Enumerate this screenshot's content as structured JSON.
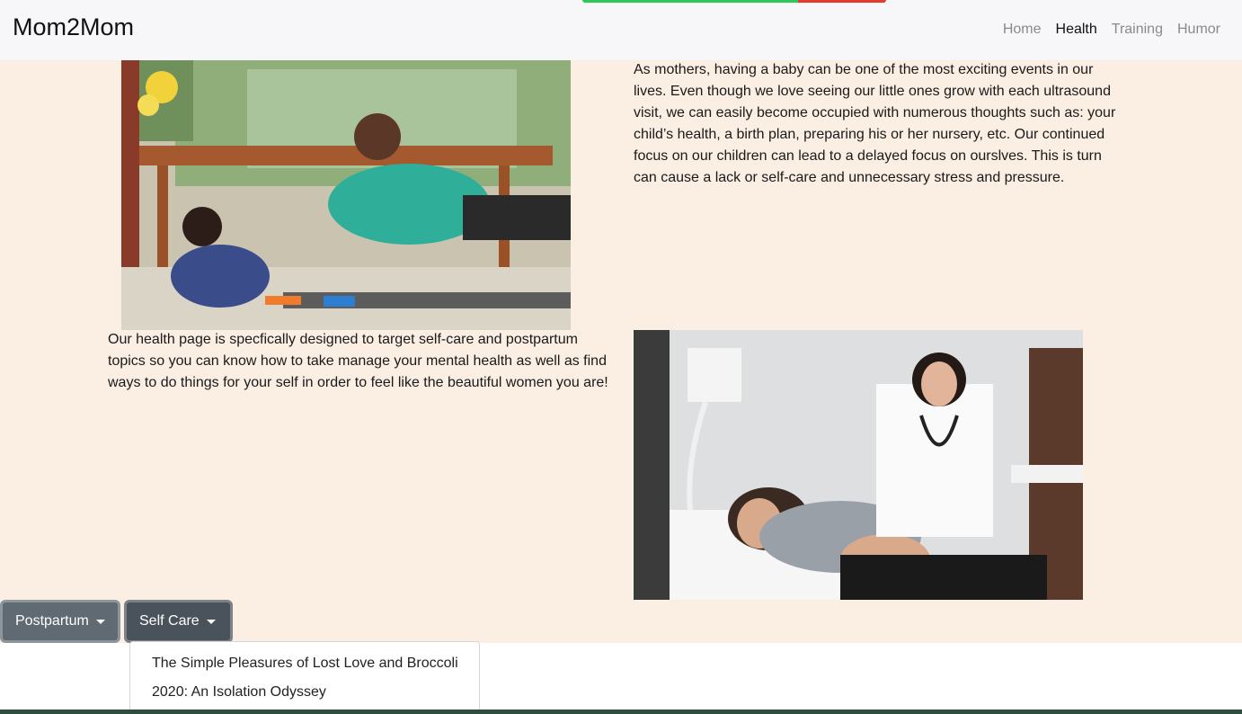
{
  "navbar": {
    "brand": "Mom2Mom",
    "links": [
      {
        "label": "Home",
        "active": false
      },
      {
        "label": "Health",
        "active": true
      },
      {
        "label": "Training",
        "active": false
      },
      {
        "label": "Humor",
        "active": false
      }
    ],
    "progress": {
      "filled_fraction": 0.71,
      "fill_color": "#2ec95a",
      "rest_color": "#e23b2e"
    }
  },
  "content": {
    "background_color": "#fbeee2",
    "paragraph_1": "As mothers, having a baby can be one of the most exciting events in our lives. Even though we love seeing our little ones grow with each ultrasound visit, we can easily become occupied with numerous thoughts such as: your child’s health, a birth plan, preparing his or her nursery, etc. Our continued focus on our children can lead to a delayed focus on ourslves. This is turn can cause a lack or self-care and unnecessary stress and pressure.",
    "paragraph_2": "Our health page is specfically designed to target self-care and postpartum topics so you can know how to take manage your mental health as well as find ways to do things for your self in order to feel like the beautiful women you are!"
  },
  "buttons": {
    "postpartum": "Postpartum",
    "self_care": "Self Care"
  },
  "dropdown": {
    "items": [
      "The Simple Pleasures of Lost Love and Broccoli",
      "2020: An Isolation Odyssey"
    ]
  }
}
